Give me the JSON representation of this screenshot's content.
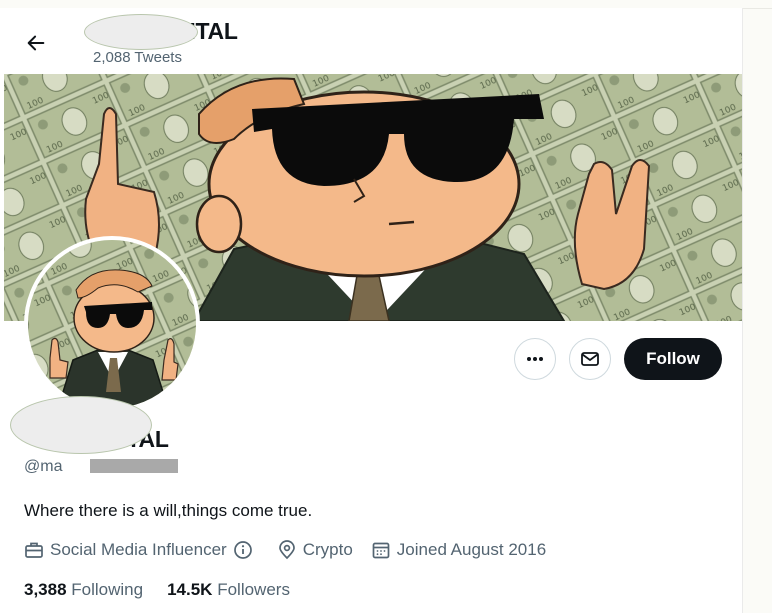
{
  "header": {
    "title_visible": "CAPITAL",
    "tweet_count": "2,088 Tweets"
  },
  "icons": {
    "back": "arrow-left-icon",
    "more": "more-horizontal-icon",
    "message": "envelope-icon",
    "category": "briefcase-icon",
    "info": "info-circle-icon",
    "location": "location-pin-icon",
    "calendar": "calendar-icon"
  },
  "profile": {
    "name_visible": "CAPITAL",
    "handle_visible": "@ma",
    "bio": "Where there is a will,things come true.",
    "category": "Social Media Influencer",
    "location": "Crypto",
    "joined": "Joined August 2016",
    "following_count": "3,388",
    "following_label": "Following",
    "followers_count": "14.5K",
    "followers_label": "Followers"
  },
  "actions": {
    "follow_label": "Follow"
  },
  "colors": {
    "text_primary": "#0f1419",
    "text_secondary": "#536471",
    "follow_bg": "#0f1419",
    "banner_money": "#a9b58f",
    "skin": "#f4b98a",
    "hair": "#e5a06a"
  }
}
